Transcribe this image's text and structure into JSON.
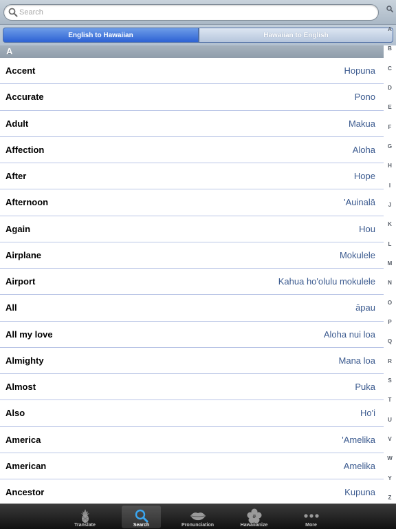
{
  "search": {
    "placeholder": "Search"
  },
  "segments": {
    "active": "English to Hawaiian",
    "inactive": "Hawaiian to English"
  },
  "section": {
    "letter": "A"
  },
  "entries": [
    {
      "en": "Accent",
      "hw": "Hopuna"
    },
    {
      "en": "Accurate",
      "hw": "Pono"
    },
    {
      "en": "Adult",
      "hw": "Makua"
    },
    {
      "en": "Affection",
      "hw": "Aloha"
    },
    {
      "en": "After",
      "hw": "Hope"
    },
    {
      "en": "Afternoon",
      "hw": "'Auinalā"
    },
    {
      "en": "Again",
      "hw": "Hou"
    },
    {
      "en": "Airplane",
      "hw": "Mokulele"
    },
    {
      "en": "Airport",
      "hw": "Kahua ho'olulu mokulele"
    },
    {
      "en": "All",
      "hw": "āpau"
    },
    {
      "en": "All my love",
      "hw": "Aloha nui loa"
    },
    {
      "en": "Almighty",
      "hw": "Mana loa"
    },
    {
      "en": "Almost",
      "hw": "Puka"
    },
    {
      "en": "Also",
      "hw": "Ho'i"
    },
    {
      "en": "America",
      "hw": "'Amelika"
    },
    {
      "en": "American",
      "hw": "Amelika"
    },
    {
      "en": "Ancestor",
      "hw": "Kupuna"
    }
  ],
  "index": [
    "A",
    "B",
    "C",
    "D",
    "E",
    "F",
    "G",
    "H",
    "I",
    "J",
    "K",
    "L",
    "M",
    "N",
    "O",
    "P",
    "Q",
    "R",
    "S",
    "T",
    "U",
    "V",
    "W",
    "Y",
    "Z"
  ],
  "tabs": [
    {
      "label": "Translate",
      "icon": "pineapple-icon"
    },
    {
      "label": "Search",
      "icon": "magnifier-icon"
    },
    {
      "label": "Pronunciation",
      "icon": "lips-icon"
    },
    {
      "label": "Hawaiianize",
      "icon": "hibiscus-icon"
    },
    {
      "label": "More",
      "icon": "more-dots-icon"
    }
  ],
  "colors": {
    "accent": "#2d62d4",
    "link_text": "#3b5a8f",
    "separator": "#b9c5e6"
  }
}
